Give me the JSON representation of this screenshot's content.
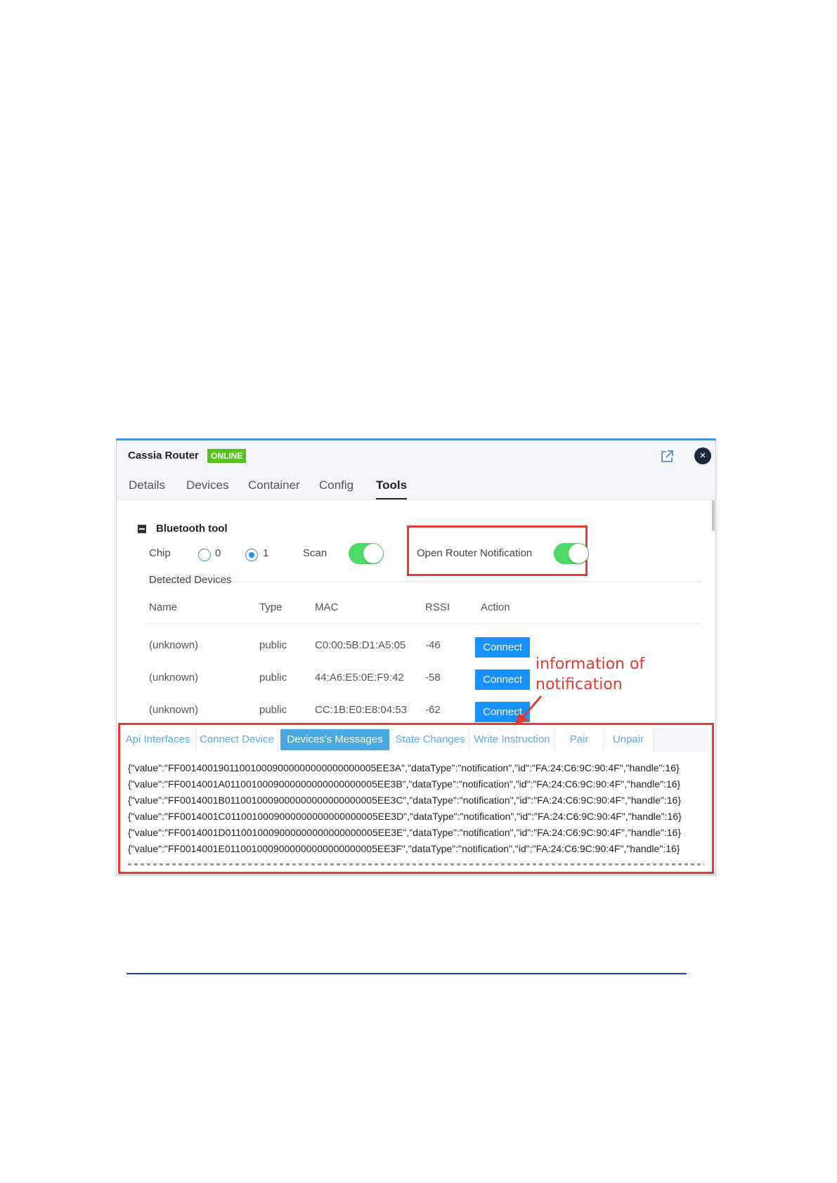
{
  "window": {
    "title": "Cassia Router",
    "status_badge": "ONLINE",
    "close_glyph": "×",
    "colors": {
      "accent": "#1890ff",
      "online": "#52c41a",
      "toggle_on": "#4cd964",
      "annotation": "#e53935"
    }
  },
  "tabs": [
    "Details",
    "Devices",
    "Container",
    "Config",
    "Tools"
  ],
  "active_tab": "Tools",
  "bluetooth_tool": {
    "title": "Bluetooth tool",
    "chip_label": "Chip",
    "chip_options": [
      "0",
      "1"
    ],
    "chip_selected": "1",
    "scan_label": "Scan",
    "scan_on": true,
    "notification_label": "Open Router Notification",
    "notification_on": true,
    "detected_title": "Detected Devices"
  },
  "table": {
    "columns": [
      "Name",
      "Type",
      "MAC",
      "RSSI",
      "Action"
    ],
    "rows": [
      {
        "name": "(unknown)",
        "type": "public",
        "mac": "C0:00:5B:D1:A5:05",
        "rssi": "-46",
        "action": "Connect"
      },
      {
        "name": "(unknown)",
        "type": "public",
        "mac": "44:A6:E5:0E:F9:42",
        "rssi": "-58",
        "action": "Connect"
      },
      {
        "name": "(unknown)",
        "type": "public",
        "mac": "CC:1B:E0:E8:04:53",
        "rssi": "-62",
        "action": "Connect"
      }
    ]
  },
  "annotation": {
    "line1": "information of",
    "line2": "notification"
  },
  "bottom_tabs": [
    "Api Interfaces",
    "Connect Device",
    "Devices's Messages",
    "State Changes",
    "Write Instruction",
    "Pair",
    "Unpair"
  ],
  "bottom_active": "Devices's Messages",
  "messages": [
    "{\"value\":\"FF001400190110010009000000000000000005EE3A\",\"dataType\":\"notification\",\"id\":\"FA:24:C6:9C:90:4F\",\"handle\":16}",
    "{\"value\":\"FF0014001A0110010009000000000000000005EE3B\",\"dataType\":\"notification\",\"id\":\"FA:24:C6:9C:90:4F\",\"handle\":16}",
    "{\"value\":\"FF0014001B0110010009000000000000000005EE3C\",\"dataType\":\"notification\",\"id\":\"FA:24:C6:9C:90:4F\",\"handle\":16}",
    "{\"value\":\"FF0014001C0110010009000000000000000005EE3D\",\"dataType\":\"notification\",\"id\":\"FA:24:C6:9C:90:4F\",\"handle\":16}",
    "{\"value\":\"FF0014001D0110010009000000000000000005EE3E\",\"dataType\":\"notification\",\"id\":\"FA:24:C6:9C:90:4F\",\"handle\":16}",
    "{\"value\":\"FF0014001E0110010009000000000000000005EE3F\",\"dataType\":\"notification\",\"id\":\"FA:24:C6:9C:90:4F\",\"handle\":16}"
  ]
}
